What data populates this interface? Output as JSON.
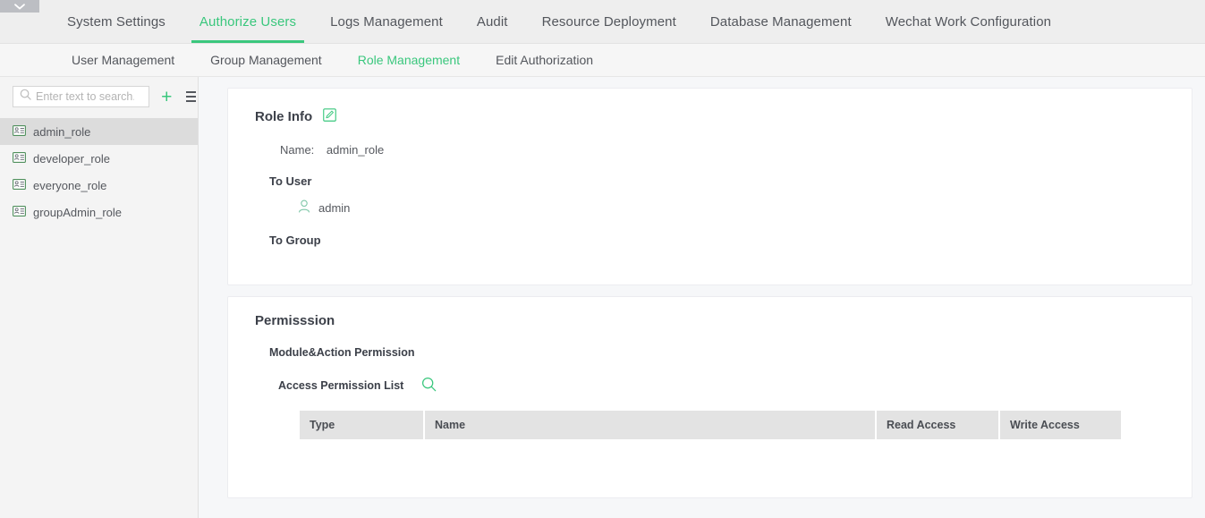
{
  "window": {
    "collapse_toggle_icon": "chevron-down-icon"
  },
  "main_nav": {
    "items": [
      {
        "label": "System Settings",
        "active": false
      },
      {
        "label": "Authorize Users",
        "active": true
      },
      {
        "label": "Logs Management",
        "active": false
      },
      {
        "label": "Audit",
        "active": false
      },
      {
        "label": "Resource Deployment",
        "active": false
      },
      {
        "label": "Database Management",
        "active": false
      },
      {
        "label": "Wechat Work Configuration",
        "active": false
      }
    ]
  },
  "sub_nav": {
    "items": [
      {
        "label": "User Management",
        "active": false
      },
      {
        "label": "Group Management",
        "active": false
      },
      {
        "label": "Role Management",
        "active": true
      },
      {
        "label": "Edit Authorization",
        "active": false
      }
    ]
  },
  "sidebar": {
    "search": {
      "value": "",
      "placeholder": "Enter text to search.",
      "icon": "search-icon"
    },
    "add_button": {
      "label": "+",
      "icon": "plus-icon"
    },
    "menu_button": {
      "icon": "list-menu-icon"
    },
    "roles": [
      {
        "label": "admin_role",
        "selected": true
      },
      {
        "label": "developer_role",
        "selected": false
      },
      {
        "label": "everyone_role",
        "selected": false
      },
      {
        "label": "groupAdmin_role",
        "selected": false
      }
    ]
  },
  "role_info": {
    "title": "Role Info",
    "edit_icon": "edit-pencil-icon",
    "name_label": "Name:",
    "name_value": "admin_role",
    "to_user_label": "To User",
    "users": [
      {
        "name": "admin",
        "icon": "user-icon"
      }
    ],
    "to_group_label": "To Group",
    "groups": []
  },
  "permission": {
    "title": "Permisssion",
    "module_action_label": "Module&Action Permission",
    "access_list_label": "Access Permission List",
    "search_icon": "search-icon",
    "table": {
      "columns": [
        "Type",
        "Name",
        "Read Access",
        "Write Access"
      ],
      "rows": []
    }
  },
  "colors": {
    "accent_green": "#3ac77d",
    "topbar_bg": "#eeeeee",
    "page_bg": "#f6f7f9",
    "sidebar_bg": "#f4f4f4",
    "selected_row": "#dcdcdc",
    "table_header_bg": "#e3e3e3",
    "text": "#55585e"
  }
}
